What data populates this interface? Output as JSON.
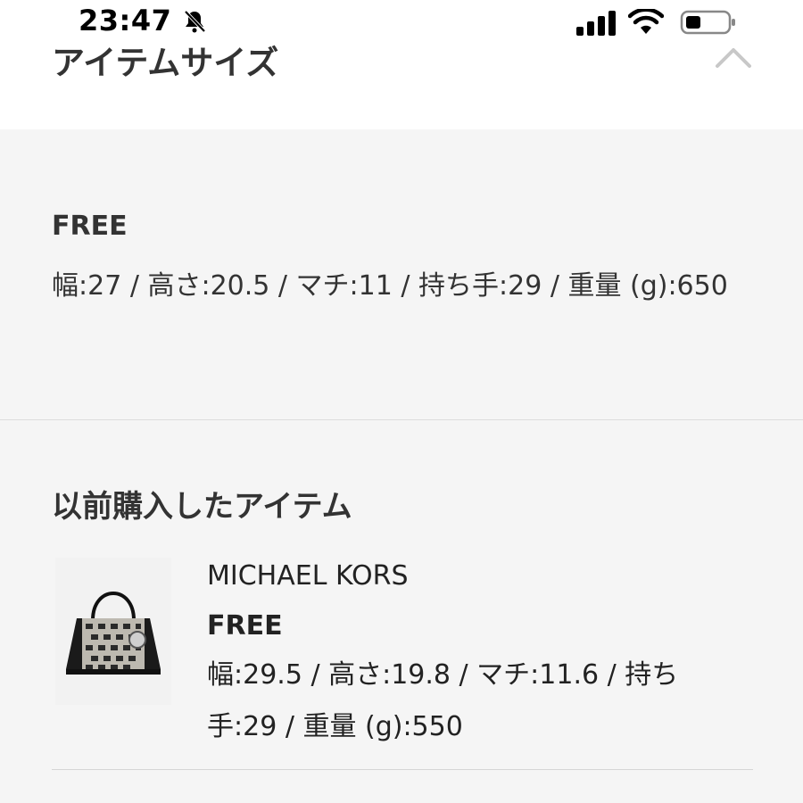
{
  "status_bar": {
    "time": "23:47",
    "icons": [
      "bell-slash-icon",
      "signal-icon",
      "wifi-icon",
      "battery-icon"
    ]
  },
  "header": {
    "title": "アイテムサイズ",
    "chevron_icon": "chevron-up-icon"
  },
  "item_size": {
    "size_label": "FREE",
    "description": "幅:27 / 高さ:20.5 / マチ:11 / 持ち手:29 / 重量 (g):650"
  },
  "previous_purchase": {
    "section_title": "以前購入したアイテム",
    "brand": "MICHAEL KORS",
    "size_label": "FREE",
    "description": "幅:29.5 / 高さ:19.8 / マチ:11.6 / 持ち手:29 / 重量 (g):550",
    "image_icon": "handbag-image"
  },
  "colors": {
    "panel_bg": "#f5f5f5",
    "header_bg": "#ffffff",
    "text": "#333333",
    "divider": "#dcdcdc"
  }
}
